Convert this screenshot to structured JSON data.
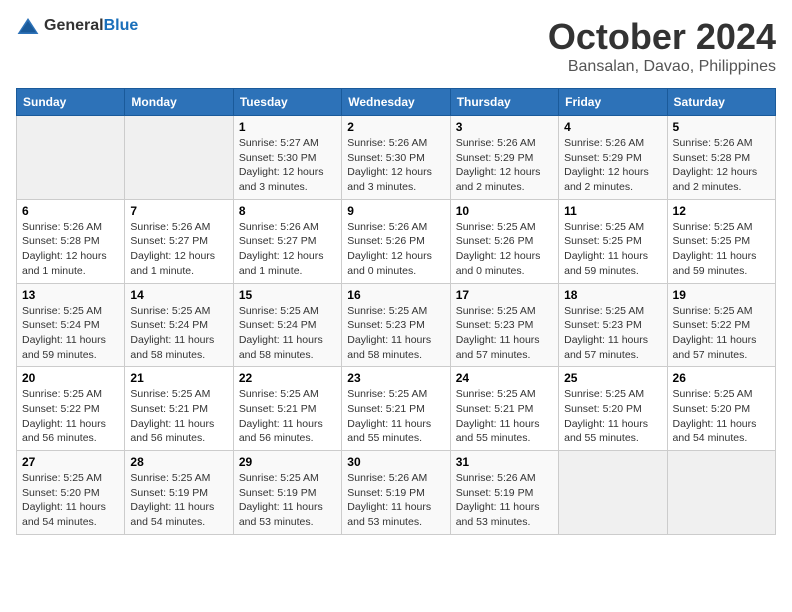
{
  "header": {
    "logo": {
      "general": "General",
      "blue": "Blue"
    },
    "title": "October 2024",
    "location": "Bansalan, Davao, Philippines"
  },
  "calendar": {
    "days_of_week": [
      "Sunday",
      "Monday",
      "Tuesday",
      "Wednesday",
      "Thursday",
      "Friday",
      "Saturday"
    ],
    "weeks": [
      [
        {
          "day": "",
          "info": ""
        },
        {
          "day": "",
          "info": ""
        },
        {
          "day": "1",
          "info": "Sunrise: 5:27 AM\nSunset: 5:30 PM\nDaylight: 12 hours and 3 minutes."
        },
        {
          "day": "2",
          "info": "Sunrise: 5:26 AM\nSunset: 5:30 PM\nDaylight: 12 hours and 3 minutes."
        },
        {
          "day": "3",
          "info": "Sunrise: 5:26 AM\nSunset: 5:29 PM\nDaylight: 12 hours and 2 minutes."
        },
        {
          "day": "4",
          "info": "Sunrise: 5:26 AM\nSunset: 5:29 PM\nDaylight: 12 hours and 2 minutes."
        },
        {
          "day": "5",
          "info": "Sunrise: 5:26 AM\nSunset: 5:28 PM\nDaylight: 12 hours and 2 minutes."
        }
      ],
      [
        {
          "day": "6",
          "info": "Sunrise: 5:26 AM\nSunset: 5:28 PM\nDaylight: 12 hours and 1 minute."
        },
        {
          "day": "7",
          "info": "Sunrise: 5:26 AM\nSunset: 5:27 PM\nDaylight: 12 hours and 1 minute."
        },
        {
          "day": "8",
          "info": "Sunrise: 5:26 AM\nSunset: 5:27 PM\nDaylight: 12 hours and 1 minute."
        },
        {
          "day": "9",
          "info": "Sunrise: 5:26 AM\nSunset: 5:26 PM\nDaylight: 12 hours and 0 minutes."
        },
        {
          "day": "10",
          "info": "Sunrise: 5:25 AM\nSunset: 5:26 PM\nDaylight: 12 hours and 0 minutes."
        },
        {
          "day": "11",
          "info": "Sunrise: 5:25 AM\nSunset: 5:25 PM\nDaylight: 11 hours and 59 minutes."
        },
        {
          "day": "12",
          "info": "Sunrise: 5:25 AM\nSunset: 5:25 PM\nDaylight: 11 hours and 59 minutes."
        }
      ],
      [
        {
          "day": "13",
          "info": "Sunrise: 5:25 AM\nSunset: 5:24 PM\nDaylight: 11 hours and 59 minutes."
        },
        {
          "day": "14",
          "info": "Sunrise: 5:25 AM\nSunset: 5:24 PM\nDaylight: 11 hours and 58 minutes."
        },
        {
          "day": "15",
          "info": "Sunrise: 5:25 AM\nSunset: 5:24 PM\nDaylight: 11 hours and 58 minutes."
        },
        {
          "day": "16",
          "info": "Sunrise: 5:25 AM\nSunset: 5:23 PM\nDaylight: 11 hours and 58 minutes."
        },
        {
          "day": "17",
          "info": "Sunrise: 5:25 AM\nSunset: 5:23 PM\nDaylight: 11 hours and 57 minutes."
        },
        {
          "day": "18",
          "info": "Sunrise: 5:25 AM\nSunset: 5:23 PM\nDaylight: 11 hours and 57 minutes."
        },
        {
          "day": "19",
          "info": "Sunrise: 5:25 AM\nSunset: 5:22 PM\nDaylight: 11 hours and 57 minutes."
        }
      ],
      [
        {
          "day": "20",
          "info": "Sunrise: 5:25 AM\nSunset: 5:22 PM\nDaylight: 11 hours and 56 minutes."
        },
        {
          "day": "21",
          "info": "Sunrise: 5:25 AM\nSunset: 5:21 PM\nDaylight: 11 hours and 56 minutes."
        },
        {
          "day": "22",
          "info": "Sunrise: 5:25 AM\nSunset: 5:21 PM\nDaylight: 11 hours and 56 minutes."
        },
        {
          "day": "23",
          "info": "Sunrise: 5:25 AM\nSunset: 5:21 PM\nDaylight: 11 hours and 55 minutes."
        },
        {
          "day": "24",
          "info": "Sunrise: 5:25 AM\nSunset: 5:21 PM\nDaylight: 11 hours and 55 minutes."
        },
        {
          "day": "25",
          "info": "Sunrise: 5:25 AM\nSunset: 5:20 PM\nDaylight: 11 hours and 55 minutes."
        },
        {
          "day": "26",
          "info": "Sunrise: 5:25 AM\nSunset: 5:20 PM\nDaylight: 11 hours and 54 minutes."
        }
      ],
      [
        {
          "day": "27",
          "info": "Sunrise: 5:25 AM\nSunset: 5:20 PM\nDaylight: 11 hours and 54 minutes."
        },
        {
          "day": "28",
          "info": "Sunrise: 5:25 AM\nSunset: 5:19 PM\nDaylight: 11 hours and 54 minutes."
        },
        {
          "day": "29",
          "info": "Sunrise: 5:25 AM\nSunset: 5:19 PM\nDaylight: 11 hours and 53 minutes."
        },
        {
          "day": "30",
          "info": "Sunrise: 5:26 AM\nSunset: 5:19 PM\nDaylight: 11 hours and 53 minutes."
        },
        {
          "day": "31",
          "info": "Sunrise: 5:26 AM\nSunset: 5:19 PM\nDaylight: 11 hours and 53 minutes."
        },
        {
          "day": "",
          "info": ""
        },
        {
          "day": "",
          "info": ""
        }
      ]
    ]
  }
}
